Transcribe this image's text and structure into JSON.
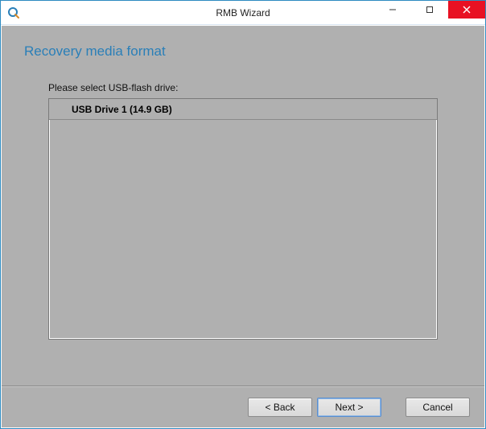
{
  "window": {
    "title": "RMB Wizard"
  },
  "page": {
    "heading": "Recovery media format",
    "prompt": "Please select USB-flash drive:"
  },
  "drives": [
    {
      "label": "USB Drive 1 (14.9 GB)"
    }
  ],
  "buttons": {
    "back": "< Back",
    "next": "Next >",
    "cancel": "Cancel"
  }
}
